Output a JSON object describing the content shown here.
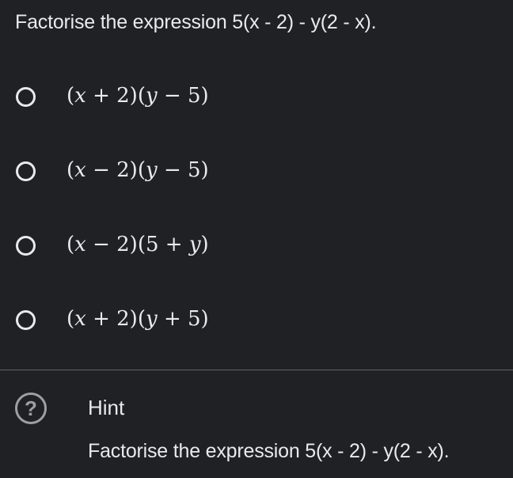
{
  "question": {
    "text": "Factorise the expression 5(x - 2) - y(2 - x)."
  },
  "options": [
    {
      "label": "(x + 2)(y − 5)",
      "parts": [
        "(",
        "x",
        " + 2)(",
        "y",
        " − 5)"
      ]
    },
    {
      "label": "(x − 2)(y − 5)",
      "parts": [
        "(",
        "x",
        " − 2)(",
        "y",
        " − 5)"
      ]
    },
    {
      "label": "(x − 2)(5 + y)",
      "parts": [
        "(",
        "x",
        " − 2)(5 + ",
        "y",
        ")"
      ]
    },
    {
      "label": "(x + 2)(y + 5)",
      "parts": [
        "(",
        "x",
        " + 2)(",
        "y",
        " + 5)"
      ]
    }
  ],
  "hint": {
    "icon": "question-circle-icon",
    "glyph": "?",
    "title": "Hint",
    "text": "Factorise the expression 5(x - 2) - y(2 - x)."
  },
  "colors": {
    "background": "#202124",
    "text": "#e8eaed",
    "muted": "#9aa0a6",
    "divider": "#5f6368"
  }
}
